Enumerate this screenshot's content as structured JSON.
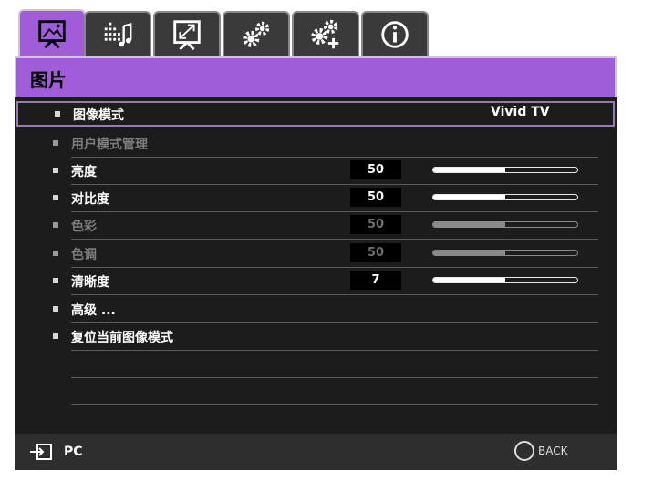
{
  "tabs": [
    {
      "name": "picture-tab",
      "icon": "picture-icon",
      "active": true
    },
    {
      "name": "audio-tab",
      "icon": "audio-icon",
      "active": false
    },
    {
      "name": "display-tab",
      "icon": "display-icon",
      "active": false
    },
    {
      "name": "basic-settings-tab",
      "icon": "gears-icon",
      "active": false
    },
    {
      "name": "advanced-settings-tab",
      "icon": "gears-plus-icon",
      "active": false
    },
    {
      "name": "info-tab",
      "icon": "info-icon",
      "active": false
    }
  ],
  "header": {
    "title": "图片"
  },
  "menu": {
    "picture_mode": {
      "label": "图像模式",
      "value": "Vivid TV"
    },
    "user_mode": {
      "label": "用户模式管理"
    },
    "brightness": {
      "label": "亮度",
      "value": "50",
      "level": 0.5
    },
    "contrast": {
      "label": "对比度",
      "value": "50",
      "level": 0.5
    },
    "color": {
      "label": "色彩",
      "value": "50",
      "level": 0.5
    },
    "tint": {
      "label": "色调",
      "value": "50",
      "level": 0.5
    },
    "sharpness": {
      "label": "清晰度",
      "value": "7",
      "level": 0.5
    },
    "advanced": {
      "label": "高级 ..."
    },
    "reset": {
      "label": "复位当前图像模式"
    }
  },
  "footer": {
    "source_label": "PC",
    "back_label": "BACK"
  },
  "colors": {
    "accent": "#a15cd9",
    "panel": "#1c1c1c"
  }
}
